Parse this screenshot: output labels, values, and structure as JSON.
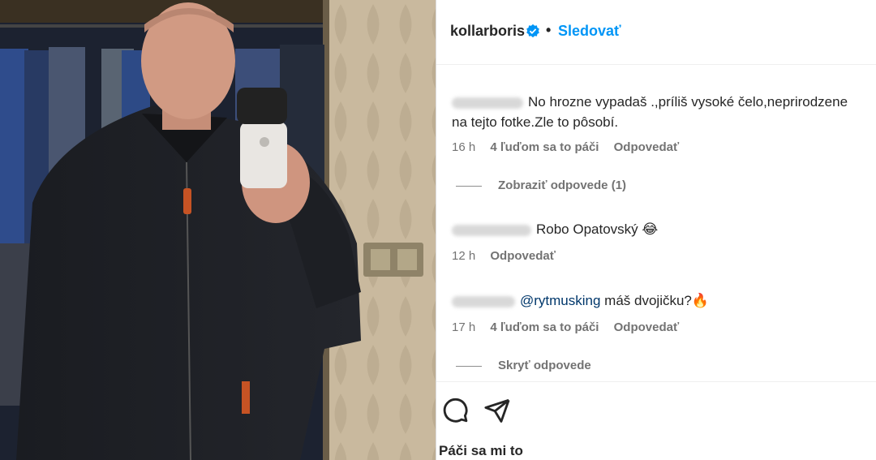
{
  "post": {
    "username": "kollarboris",
    "separator": "•",
    "follow_label": "Sledovať",
    "likes_label": "Páči sa mi to"
  },
  "comments": [
    {
      "text_line1": "No hrozne vypadaš .,príliš vysoké čelo,neprirodzene",
      "text_line2": "na tejto fotke.Zle to pôsobí.",
      "time": "16 h",
      "likes": "4 ľuďom sa to páči",
      "reply_label": "Odpovedať",
      "replies_toggle": "Zobraziť odpovede (1)"
    },
    {
      "text": "Robo Opatovský 😂",
      "time": "12 h",
      "reply_label": "Odpovedať"
    },
    {
      "mention": "@rytmusking",
      "text": " máš dvojičku?🔥",
      "time": "17 h",
      "likes": "4 ľuďom sa to páči",
      "reply_label": "Odpovedať",
      "replies_toggle": "Skryť odpovede"
    }
  ],
  "icons": [
    "verified-icon",
    "comment-icon",
    "share-icon"
  ],
  "colors": {
    "accent": "#0095f6",
    "verified": "#0095f6",
    "mention": "#00376b",
    "muted": "#737373"
  }
}
